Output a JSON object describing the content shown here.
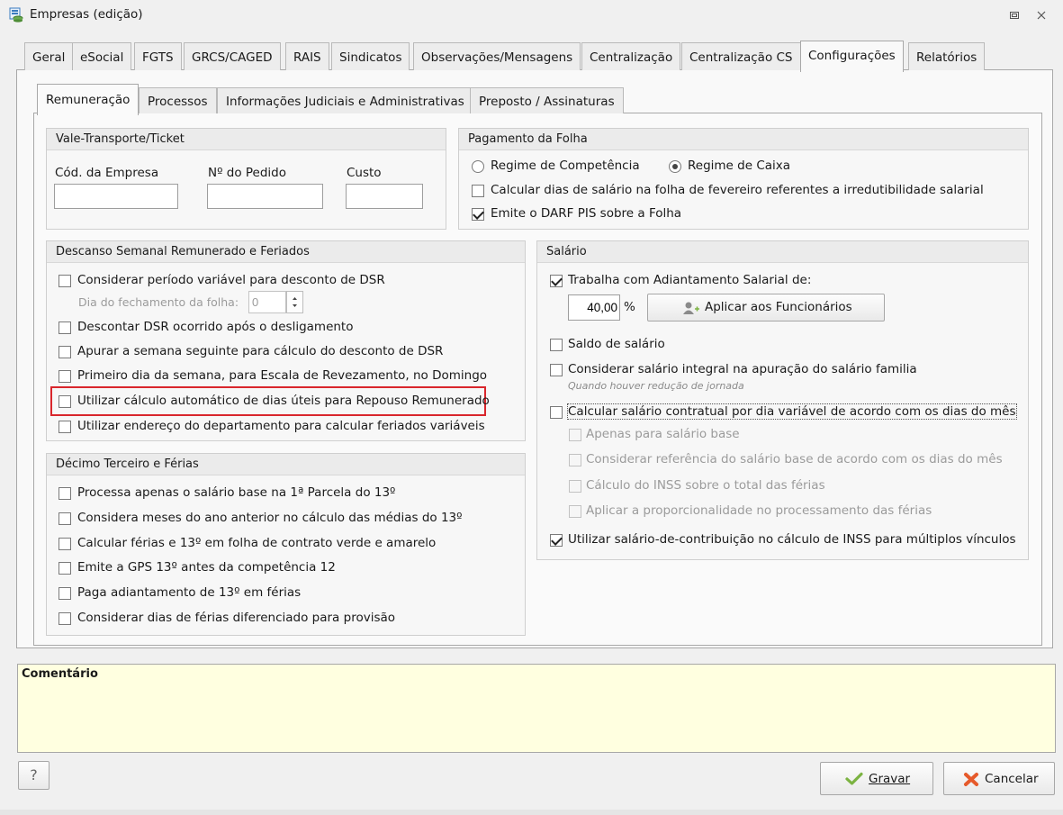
{
  "window": {
    "title": "Empresas (edição)",
    "icons": {
      "app": "company-db-icon",
      "restore": "restore-icon",
      "close": "close-icon"
    }
  },
  "tabs": [
    "Geral",
    "eSocial",
    "FGTS",
    "GRCS/CAGED",
    "RAIS",
    "Sindicatos",
    "Observações/Mensagens",
    "Centralização",
    "Centralização CS",
    "Configurações",
    "Relatórios"
  ],
  "active_tab": "Configurações",
  "subtabs": [
    "Remuneração",
    "Processos",
    "Informações Judiciais e Administrativas",
    "Preposto / Assinaturas"
  ],
  "active_subtab": "Remuneração",
  "vale": {
    "title": "Vale-Transporte/Ticket",
    "cod_label": "Cód. da Empresa",
    "cod_value": "",
    "pedido_label": "Nº do Pedido",
    "pedido_value": "",
    "custo_label": "Custo",
    "custo_value": ""
  },
  "pagamento": {
    "title": "Pagamento da Folha",
    "radio_competencia": "Regime de Competência",
    "radio_caixa": "Regime de Caixa",
    "selected": "Regime de Caixa",
    "cb_fevereiro": {
      "label": "Calcular dias de salário na folha de fevereiro referentes a irredutibilidade salarial",
      "checked": false
    },
    "cb_darf": {
      "label": "Emite o DARF PIS sobre a Folha",
      "checked": true
    }
  },
  "dsr": {
    "title": "Descanso Semanal Remunerado e Feriados",
    "cb_periodo": {
      "label": "Considerar período variável para desconto de DSR",
      "checked": false
    },
    "dia_fechamento_label": "Dia do fechamento da folha:",
    "dia_fechamento_value": "0",
    "cb_desligamento": {
      "label": "Descontar DSR ocorrido após o desligamento",
      "checked": false
    },
    "cb_semana": {
      "label": "Apurar a semana seguinte para cálculo do desconto de DSR",
      "checked": false
    },
    "cb_primeiro_dia": {
      "label": "Primeiro dia da semana, para Escala de Revezamento, no Domingo",
      "checked": false
    },
    "cb_dias_uteis": {
      "label": "Utilizar cálculo automático de dias úteis para Repouso Remunerado",
      "checked": false
    },
    "cb_endereco": {
      "label": "Utilizar endereço do departamento para calcular feriados variáveis",
      "checked": false
    },
    "highlight_color": "#d9262c"
  },
  "decimo": {
    "title": "Décimo Terceiro e Férias",
    "cb_1": {
      "label": "Processa apenas o salário base na 1ª Parcela do 13º",
      "checked": false
    },
    "cb_2": {
      "label": "Considera meses do ano anterior no cálculo das médias do 13º",
      "checked": false
    },
    "cb_3": {
      "label": "Calcular férias e 13º em folha de contrato verde e amarelo",
      "checked": false
    },
    "cb_4": {
      "label": "Emite a GPS 13º antes da competência 12",
      "checked": false
    },
    "cb_5": {
      "label": "Paga adiantamento de 13º em férias",
      "checked": false
    },
    "cb_6": {
      "label": "Considerar dias de férias diferenciado para provisão",
      "checked": false
    }
  },
  "salario": {
    "title": "Salário",
    "cb_adiantamento": {
      "label": "Trabalha com Adiantamento Salarial de:",
      "checked": true
    },
    "percent_value": "40,00",
    "percent_unit": "%",
    "aplicar_button": "Aplicar aos Funcionários",
    "cb_saldo": {
      "label": "Saldo de salário",
      "checked": false
    },
    "cb_integral": {
      "label": "Considerar salário integral na apuração do salário familia",
      "checked": false
    },
    "hint_integral": "Quando houver redução de jornada",
    "cb_contratual": {
      "label": "Calcular salário contratual por dia variável de acordo com os dias do mês",
      "checked": false
    },
    "cb_apenas_base": {
      "label": "Apenas para salário base",
      "checked": false
    },
    "cb_referencia": {
      "label": "Considerar referência do salário base de acordo com os dias do mês",
      "checked": false
    },
    "cb_inss_ferias": {
      "label": "Cálculo do INSS sobre o total das férias",
      "checked": false
    },
    "cb_proporcional": {
      "label": "Aplicar a proporcionalidade no processamento das férias",
      "checked": false
    },
    "cb_multiplos": {
      "label": "Utilizar salário-de-contribuição no cálculo de INSS para múltiplos vínculos",
      "checked": true
    }
  },
  "comentario": {
    "label": "Comentário",
    "value": ""
  },
  "footer": {
    "help": "?",
    "gravar": "Gravar",
    "cancelar": "Cancelar",
    "colors": {
      "gravar_icon": "#7cb342",
      "cancelar_icon": "#e65a2b"
    }
  }
}
